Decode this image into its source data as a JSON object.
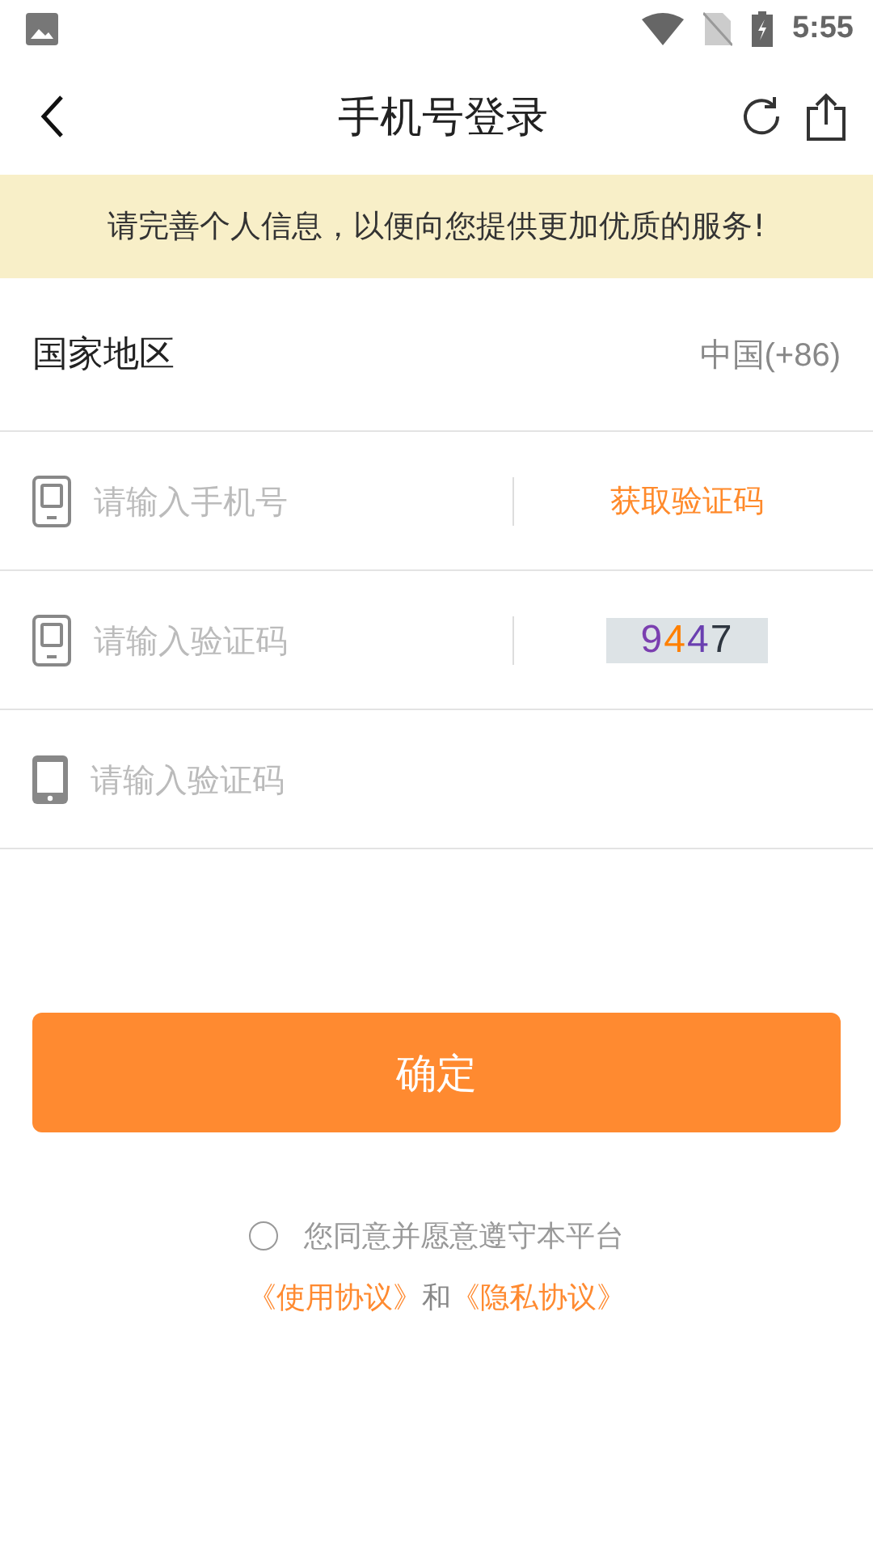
{
  "status_bar": {
    "time": "5:55"
  },
  "nav": {
    "title": "手机号登录"
  },
  "notice": "请完善个人信息，以便向您提供更加优质的服务!",
  "region": {
    "label": "国家地区",
    "value": "中国(+86)"
  },
  "fields": [
    {
      "kind": "sms",
      "placeholder": "请输入手机号",
      "action": "获取验证码"
    },
    {
      "kind": "captcha",
      "placeholder": "请输入验证码",
      "captcha": "9447"
    },
    {
      "kind": "plain",
      "placeholder": "请输入验证码"
    }
  ],
  "submit": "确定",
  "agreement": {
    "checked": false,
    "text": "您同意并愿意遵守本平台",
    "links": [
      "《使用协议》",
      "《隐私协议》"
    ],
    "joiner": "和"
  }
}
